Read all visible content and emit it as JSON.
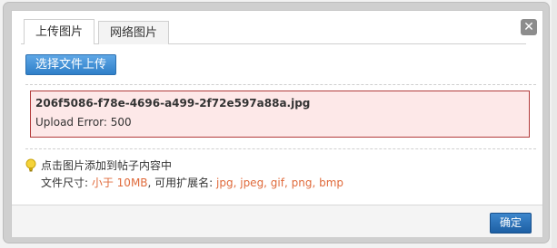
{
  "dialog": {
    "tabs": [
      {
        "label": "上传图片",
        "active": true
      },
      {
        "label": "网络图片",
        "active": false
      }
    ],
    "close_icon": "close-icon",
    "select_button_label": "选择文件上传",
    "upload_item": {
      "filename": "206f5086-f78e-4696-a499-2f72e597a88a.jpg",
      "error": "Upload Error: 500"
    },
    "hints": {
      "line1": "点击图片添加到帖子内容中",
      "size_prefix": "文件尺寸: ",
      "size_value": "小于 10MB",
      "ext_prefix": ", 可用扩展名: ",
      "ext_value": "jpg, jpeg, gif, png, bmp"
    },
    "ok_button_label": "确定"
  },
  "colors": {
    "accent": "#e06b3c",
    "button_blue": "#2f7fc8",
    "error_border": "#b23a3a",
    "error_bg": "#fde8e8"
  }
}
